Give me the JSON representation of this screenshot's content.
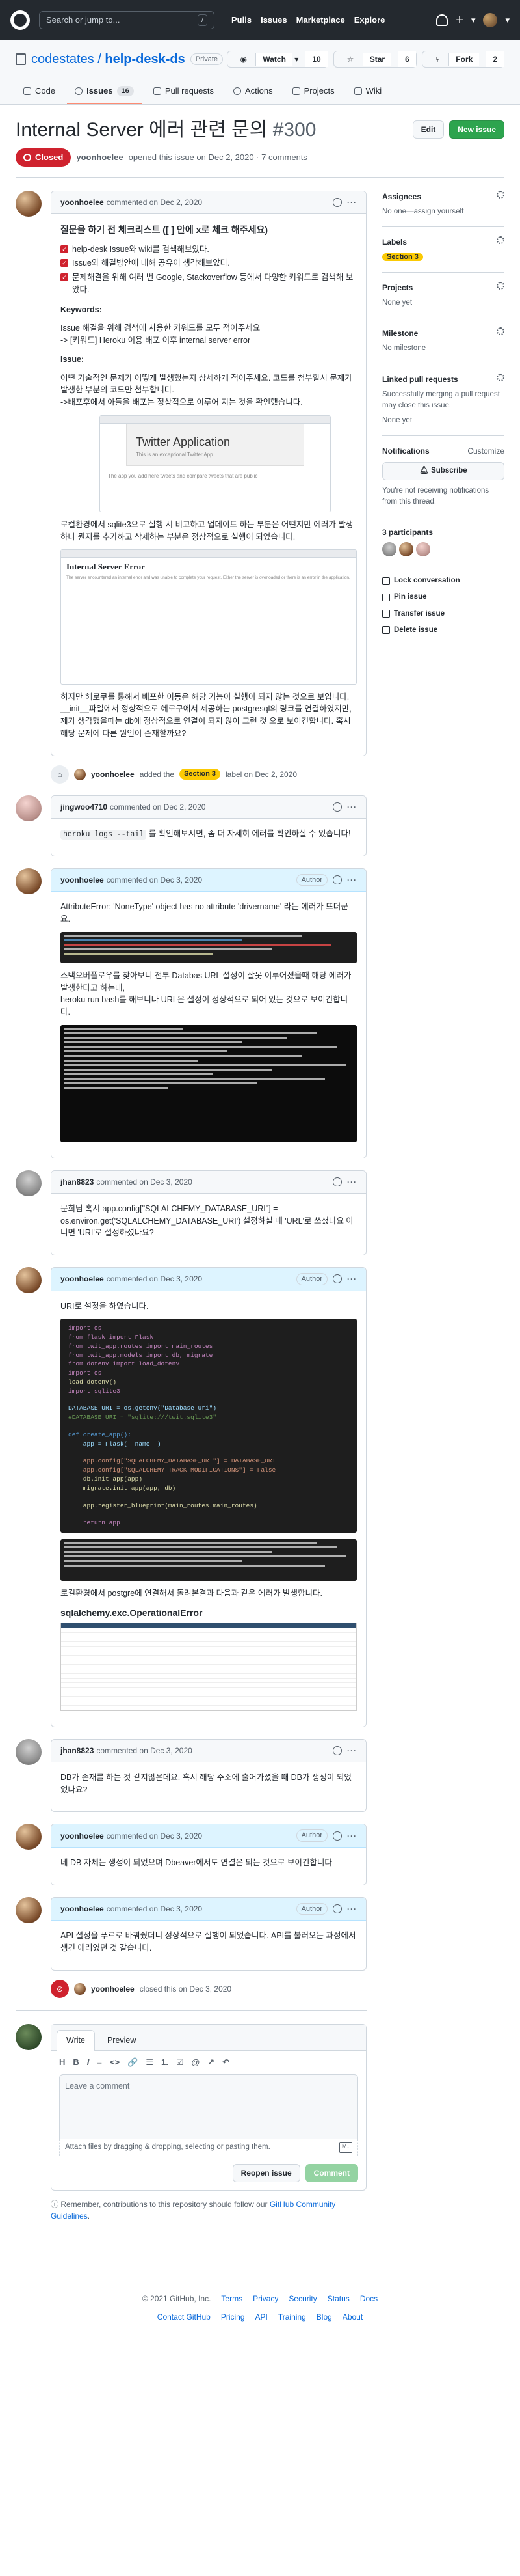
{
  "header": {
    "search_placeholder": "Search or jump to...",
    "nav": [
      "Pulls",
      "Issues",
      "Marketplace",
      "Explore"
    ]
  },
  "repo": {
    "owner": "codestates",
    "name": "help-desk-ds",
    "visibility": "Private",
    "watch_label": "Watch",
    "watch_count": "10",
    "star_label": "Star",
    "star_count": "6",
    "fork_label": "Fork",
    "fork_count": "2",
    "tabs": [
      {
        "label": "Code"
      },
      {
        "label": "Issues",
        "count": "16"
      },
      {
        "label": "Pull requests"
      },
      {
        "label": "Actions"
      },
      {
        "label": "Projects"
      },
      {
        "label": "Wiki"
      }
    ]
  },
  "issue": {
    "title": "Internal Server 에러 관련 문의",
    "number": "#300",
    "edit_label": "Edit",
    "new_issue_label": "New issue",
    "state": "Closed",
    "author": "yoonhoelee",
    "meta": "opened this issue on Dec 2, 2020 · 7 comments"
  },
  "first_comment": {
    "author": "yoonhoelee",
    "time": "commented on Dec 2, 2020",
    "heading": "질문을 하기 전 체크리스트 ([ ] 안에 x로 체크 해주세요)",
    "checklist": [
      "help-desk Issue와 wiki를 검색해보았다.",
      "Issue와 해결방안에 대해 공유이 생각해보았다.",
      "문제해결을 위해 여러 번 Google, Stackoverflow 등에서 다양한 키워드로 검색해 보았다."
    ],
    "keywords_label": "Keywords:",
    "keywords_text_1": "Issue 해결을 위해 검색에 사용한 키워드를 모두 적어주세요",
    "keywords_text_2": "-> [키워드] Heroku 이용 배포 이후 internal server error",
    "issue_label": "Issue:",
    "issue_text": "어떤 기술적인 문제가 어떻게 발생했는지 상세하게 적어주세요. 코드를 첨부할시 문제가 발생한 부분의 코드만 첨부합니다.",
    "issue_text_2": "->배포후에서 아들을 배포는 정상적으로 이루어 지는 것을 확인했습니다.",
    "twitter_title": "Twitter Application",
    "twitter_sub": "This is an exceptional Twitter App",
    "twitter_desc": "The app you add here tweets and compare tweets that are public",
    "mid_text": "로컬환경에서 sqlite3으로 실행 시 비교하고 업데이트 하는 부분은 어떤지만 에러가 발생하나 뭔지를 추가하고 삭제하는 부분은 정상적으로 실행이 되었습니다.",
    "ise_title": "Internal Server Error",
    "ise_desc": "The server encountered an internal error and was unable to complete your request. Either the server is overloaded or there is an error in the application.",
    "end_text": "히지만 헤로쿠를 통해서 배포한 이동은 해당 기능이 실행이 되지 않는 것으로 보입니다. __init__파일에서 정상적으로 헤로쿠에서 제공하는 postgresql의 링크를 연결하였지만, 제가 생각했을때는 db에 정상적으로 연결이 되지 않아 그런 것 으로 보이긴합니다. 혹시 해당 문제에 다른 원인이 존재할까요?"
  },
  "label_event": {
    "actor": "yoonhoelee",
    "pre": "added the",
    "label": "Section 3",
    "post": "label on Dec 2, 2020"
  },
  "comments": [
    {
      "author": "jingwoo4710",
      "time": "commented on Dec 2, 2020",
      "code": "heroku logs --tail",
      "text": "를 확인해보시면, 좀 더 자세히 에러를 확인하실 수 있습니다!"
    },
    {
      "author": "yoonhoelee",
      "time": "commented on Dec 3, 2020",
      "role": "Author",
      "text1": "AttributeError: 'NoneType' object has no attribute 'drivername' 라는 에러가 뜨더군요.",
      "text2": "스택오버플로우를 찾아보니 전부 Databas URL 설정이 잘못 이루어졌을때 해당 에러가 발생한다고 하는데,",
      "text3": "heroku run bash를 해보니나 URL은 설정이 정상적으로 되어 있는 것으로 보이긴합니다."
    },
    {
      "author": "jhan8823",
      "time": "commented on Dec 3, 2020",
      "text": "문희님 혹시 app.config[\"SQLALCHEMY_DATABASE_URI\"] = os.environ.get('SQLALCHEMY_DATABASE_URI') 설정하실 때 'URL'로 쓰셨나요 아니면 'URI'로 설정하셨나요?"
    },
    {
      "author": "yoonhoelee",
      "time": "commented on Dec 3, 2020",
      "role": "Author",
      "text1": "URI로 설정을 하였습니다.",
      "code_lines": [
        "import os",
        "from flask import Flask",
        "from twit_app.routes import main_routes",
        "from twit_app.models import db, migrate",
        "from dotenv import load_dotenv",
        "import os",
        "load_dotenv()",
        "import sqlite3",
        "",
        "DATABASE_URI = os.getenv(\"Database_uri\")",
        "#DATABASE_URI = \"sqlite:///twit.sqlite3\"",
        "",
        "def create_app():",
        "    app = Flask(__name__)",
        "",
        "    app.config[\"SQLALCHEMY_DATABASE_URI\"] = DATABASE_URI",
        "    app.config[\"SQLALCHEMY_TRACK_MODIFICATIONS\"] = False",
        "    db.init_app(app)",
        "    migrate.init_app(app, db)",
        "",
        "    app.register_blueprint(main_routes.main_routes)",
        "",
        "    return app"
      ],
      "text2": "로컬환경에서 postgre에 연결해서 돌려본결과 다음과 같은 에러가 발생합니다.",
      "error_title": "sqlalchemy.exc.OperationalError"
    },
    {
      "author": "jhan8823",
      "time": "commented on Dec 3, 2020",
      "text": "DB가 존재를 하는 것 같지않은데요. 혹시 해당 주소에 출어가셨을 때 DB가 생성이 되었었나요?"
    },
    {
      "author": "yoonhoelee",
      "time": "commented on Dec 3, 2020",
      "role": "Author",
      "text": "네 DB 자체는 생성이 되었으며 Dbeaver에서도 연결은 되는 것으로 보이긴합니다"
    },
    {
      "author": "yoonhoelee",
      "time": "commented on Dec 3, 2020",
      "role": "Author",
      "text": "API 설정을 푸르로 바꿔줬더니 정상적으로 실행이 되었습니다. API를 불러오는 과정에서 생긴 에러였던 것 같습니다."
    }
  ],
  "close_event": {
    "actor": "yoonhoelee",
    "text": "closed this on Dec 3, 2020"
  },
  "editor": {
    "tab_write": "Write",
    "tab_preview": "Preview",
    "toolbar": [
      "H",
      "B",
      "I",
      "≡",
      "<>",
      "🔗",
      "☰",
      "1.",
      "☑",
      "@",
      "↗",
      "↶"
    ],
    "placeholder": "Leave a comment",
    "attach_text": "Attach files by dragging & dropping, selecting or pasting them.",
    "reopen_label": "Reopen issue",
    "comment_label": "Comment",
    "remember_pre": "Remember, contributions to this repository should follow our",
    "remember_link": "GitHub Community Guidelines",
    "remember_post": "."
  },
  "sidebar": {
    "assignees_title": "Assignees",
    "assignees_text": "No one—assign yourself",
    "labels_title": "Labels",
    "label_value": "Section 3",
    "projects_title": "Projects",
    "projects_text": "None yet",
    "milestone_title": "Milestone",
    "milestone_text": "No milestone",
    "linked_title": "Linked pull requests",
    "linked_text": "Successfully merging a pull request may close this issue.",
    "linked_none": "None yet",
    "notifications_title": "Notifications",
    "customize_label": "Customize",
    "subscribe_label": "Subscribe",
    "notif_text": "You're not receiving notifications from this thread.",
    "participants_title": "3 participants",
    "actions": [
      "Lock conversation",
      "Pin issue",
      "Transfer issue",
      "Delete issue"
    ]
  },
  "footer": {
    "copyright": "© 2021 GitHub, Inc.",
    "row1": [
      "Terms",
      "Privacy",
      "Security",
      "Status",
      "Docs"
    ],
    "row2": [
      "Contact GitHub",
      "Pricing",
      "API",
      "Training",
      "Blog",
      "About"
    ]
  },
  "colors": {
    "accent": "#0969da",
    "closed": "#cf222e",
    "green": "#2da44e",
    "label_yellow": "#fbca04"
  }
}
